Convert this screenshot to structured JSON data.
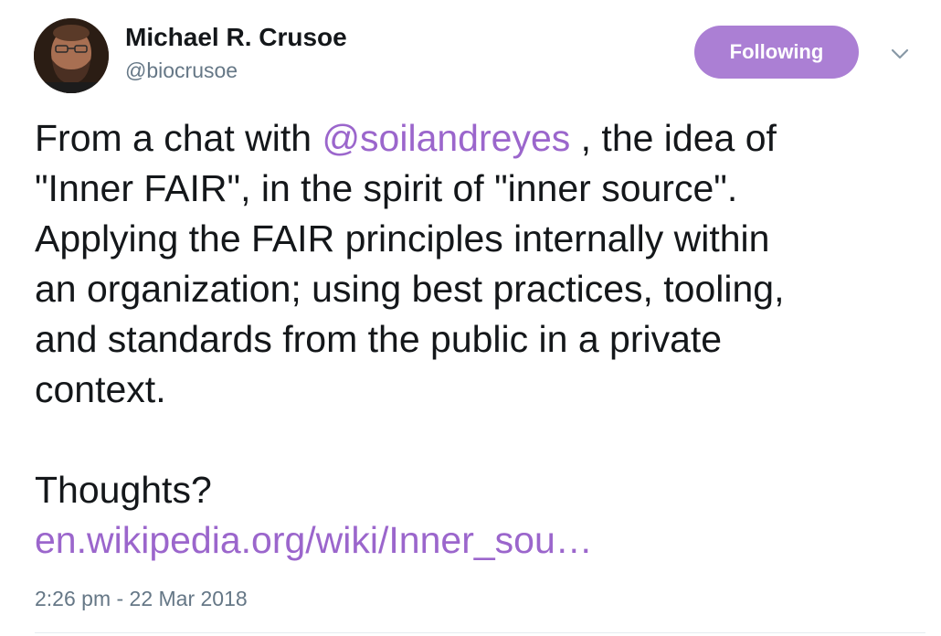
{
  "author": {
    "name": "Michael R. Crusoe",
    "handle": "@biocrusoe"
  },
  "follow_button": {
    "label": "Following",
    "color": "#ab7fd4"
  },
  "menu_icon": "chevron-down-icon",
  "tweet": {
    "line1_before": "From a chat with ",
    "mention": "@soilandreyes",
    "line1_after": " , the idea of",
    "line2": "\"Inner FAIR\", in the spirit of \"inner source\".",
    "line3": "Applying the FAIR principles internally within",
    "line4": "an organization; using best practices, tooling,",
    "line5": "and standards from the public in a private",
    "line6": "context.",
    "line7": "Thoughts?",
    "link": "en.wikipedia.org/wiki/Inner_sou…"
  },
  "timestamp": "2:26 pm - 22 Mar 2018",
  "colors": {
    "link": "#9b66cc",
    "secondary_text": "#657786",
    "primary_text": "#14171a"
  }
}
